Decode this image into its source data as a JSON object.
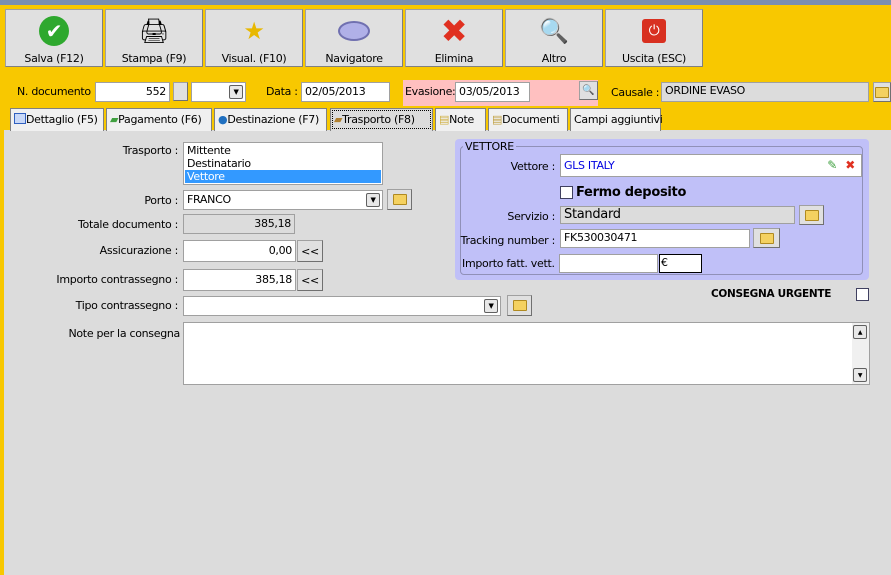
{
  "toolbar": [
    {
      "label": "Salva (F12)",
      "icon": "check-icon"
    },
    {
      "label": "Stampa (F9)",
      "icon": "printer-icon"
    },
    {
      "label": "Visual. (F10)",
      "icon": "magic-wand-icon"
    },
    {
      "label": "Navigatore",
      "icon": "compass-icon"
    },
    {
      "label": "Elimina",
      "icon": "delete-x-icon"
    },
    {
      "label": "Altro",
      "icon": "book-search-icon"
    },
    {
      "label": "Uscita (ESC)",
      "icon": "power-icon"
    }
  ],
  "header": {
    "ndoc_label": "N. documento :",
    "ndoc_value": "552",
    "data_label": "Data :",
    "data_value": "02/05/2013",
    "evasione_label": "Evasione:",
    "evasione_value": "03/05/2013",
    "causale_label": "Causale :",
    "causale_value": "ORDINE EVASO"
  },
  "tabs": [
    "Dettaglio (F5)",
    "Pagamento (F6)",
    "Destinazione (F7)",
    "Trasporto (F8)",
    "Note",
    "Documenti",
    "Campi aggiuntivi"
  ],
  "form": {
    "trasporto_label": "Trasporto :",
    "trasporto_options": [
      "Mittente",
      "Destinatario",
      "Vettore"
    ],
    "trasporto_selected": "Vettore",
    "porto_label": "Porto :",
    "porto_value": "FRANCO",
    "totale_label": "Totale documento :",
    "totale_value": "385,18",
    "assicurazione_label": "Assicurazione :",
    "assicurazione_value": "0,00",
    "contrassegno_label": "Importo contrassegno :",
    "contrassegno_value": "385,18",
    "tipo_label": "Tipo contrassegno :",
    "tipo_value": "",
    "note_label": "Note per la consegna",
    "note_value": "",
    "back_btn": "<<",
    "urgente_label": "CONSEGNA URGENTE"
  },
  "vettore": {
    "title": "VETTORE",
    "vettore_label": "Vettore :",
    "vettore_value": "GLS ITALY",
    "fermo_label": "Fermo deposito",
    "servizio_label": "Servizio :",
    "servizio_value": "Standard",
    "tracking_label": "Tracking number :",
    "tracking_value": "FK530030471",
    "importo_label": "Importo fatt. vett.",
    "importo_value": "",
    "currency": "€"
  },
  "colors": {
    "background": "#F8C800",
    "panel": "#C0C0F8",
    "selection": "#3399FF",
    "evasione": "#FFC0C0"
  }
}
